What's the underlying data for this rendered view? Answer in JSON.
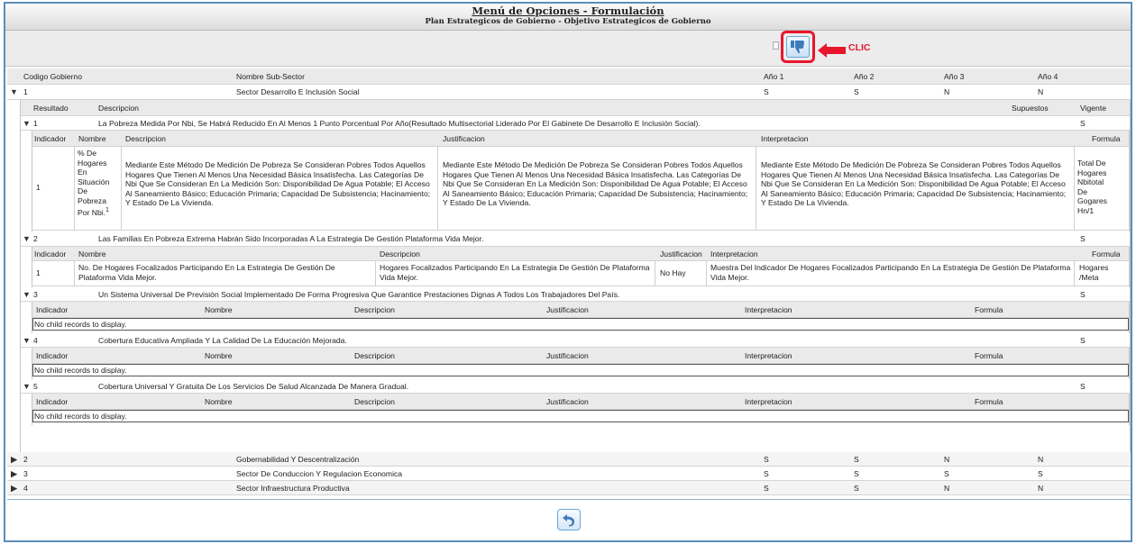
{
  "header": {
    "title": "Menú de Opciones - Formulación",
    "subtitle": "Plan Estrategicos de Gobierno - Objetivo Estrategicos de Gobierno"
  },
  "toolbar": {
    "annotation": "CLIC",
    "icon": "thumbs-down-icon",
    "annotation_color": "#e8162c"
  },
  "columns": [
    "Codigo Gobierno",
    "Nombre Sub-Sector",
    "Año 1",
    "Año 2",
    "Año 3",
    "Año 4"
  ],
  "sectors": [
    {
      "code": "1",
      "name": "Sector Desarrollo E Inclusión Social",
      "y1": "S",
      "y2": "S",
      "y3": "N",
      "y4": "N"
    },
    {
      "code": "2",
      "name": "Gobernabilidad Y Descentralización",
      "y1": "S",
      "y2": "S",
      "y3": "N",
      "y4": "N"
    },
    {
      "code": "3",
      "name": "Sector De Conduccion Y Regulacion Economica",
      "y1": "S",
      "y2": "S",
      "y3": "S",
      "y4": "S"
    },
    {
      "code": "4",
      "name": "Sector Infraestructura Productiva",
      "y1": "S",
      "y2": "S",
      "y3": "N",
      "y4": "N"
    }
  ],
  "results_header": [
    "Resultado",
    "Descripcion",
    "Supuestos",
    "Vigente"
  ],
  "results": [
    {
      "id": "1",
      "desc": "La Pobreza Medida Por Nbi, Se Habrá Reducido En Al Menos 1 Punto Porcentual Por Año(Resultado Multisectorial Liderado Por El Gabinete De Desarrollo E Inclusión Social).",
      "vigente": "S"
    },
    {
      "id": "2",
      "desc": "Las Familias En Pobreza Extrema Habrán Sido Incorporadas A La Estrategia De Gestión Plataforma Vida Mejor.",
      "vigente": "S"
    },
    {
      "id": "3",
      "desc": "Un Sistema Universal De Previsión Social Implementado De Forma Progresiva Que Garantice Prestaciones Dignas A Todos Los Trabajadores Del País.",
      "vigente": "S"
    },
    {
      "id": "4",
      "desc": "Cobertura Educativa Ampliada Y La Calidad De La Educación Mejorada.",
      "vigente": "S"
    },
    {
      "id": "5",
      "desc": "Cobertura Universal Y Gratuita De Los Servicios De Salud Alcanzada De Manera Gradual.",
      "vigente": "S"
    }
  ],
  "indicator_header": [
    "Indicador",
    "Nombre",
    "Descripcion",
    "Justificacion",
    "Interpretacion",
    "Formula"
  ],
  "ind1": {
    "id": "1",
    "name": "% De Hogares En Situación De Pobreza Por Nbi.",
    "sup": "1",
    "desc": "Mediante Este Método De Medición De Pobreza Se Consideran Pobres Todos Aquellos Hogares Que Tienen Al Menos Una Necesidad Básica Insatisfecha. Las Categorías De Nbi Que Se Consideran En La Medición Son: Disponibilidad De Agua Potable; El Acceso Al Saneamiento Básico; Educación Primaria; Capacidad De Subsistencia; Hacinamiento; Y Estado De La Vivienda.",
    "just": "Mediante Este Método De Medición De Pobreza Se Consideran Pobres Todos Aquellos Hogares Que Tienen Al Menos Una Necesidad Básica Insatisfecha. Las Categorías De Nbi Que Se Consideran En La Medición Son: Disponibilidad De Agua Potable; El Acceso Al Saneamiento Básico; Educación Primaria; Capacidad De Subsistencia; Hacinamiento; Y Estado De La Vivienda.",
    "interp": "Mediante Este Método De Medición De Pobreza Se Consideran Pobres Todos Aquellos Hogares Que Tienen Al Menos Una Necesidad Básica Insatisfecha. Las Categorías De Nbi Que Se Consideran En La Medición Son: Disponibilidad De Agua Potable; El Acceso Al Saneamiento Básico; Educación Primaria; Capacidad De Subsistencia; Hacinamiento; Y Estado De La Vivienda.",
    "formula": "Total De Hogares Nbitotal De Gogares Hn/1"
  },
  "ind2": {
    "id": "1",
    "name": "No. De Hogares Focalizados Participando En La Estrategia De Gestión De Plataforma Vida Mejor.",
    "desc": "Hogares Focalizados Participando En La Estrategia De Gestión De Plataforma Vida Mejor.",
    "just": "No Hay",
    "interp": "Muestra Del Indicador De Hogares Focalizados Participando En La Estrategia De Gestión De Plataforma Vida Mejor.",
    "formula": "Hogares /Meta"
  },
  "no_records": "No child records to display."
}
